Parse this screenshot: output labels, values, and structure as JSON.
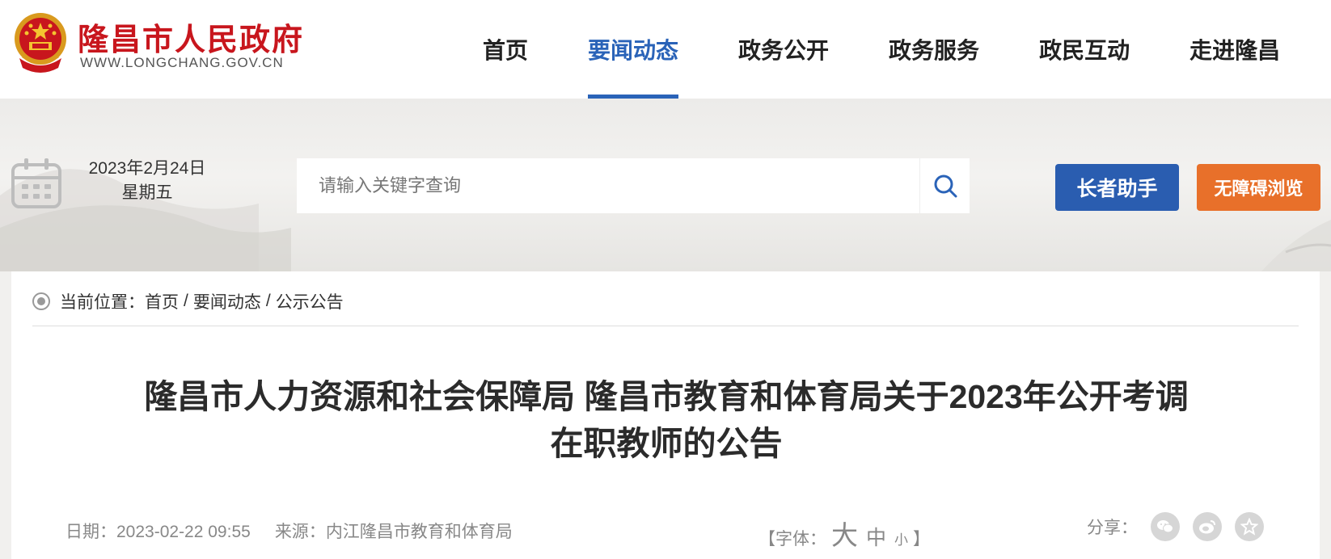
{
  "header": {
    "site_name": "隆昌市人民政府",
    "site_domain": "WWW.LONGCHANG.GOV.CN",
    "nav": [
      {
        "label": "首页",
        "active": false
      },
      {
        "label": "要闻动态",
        "active": true
      },
      {
        "label": "政务公开",
        "active": false
      },
      {
        "label": "政务服务",
        "active": false
      },
      {
        "label": "政民互动",
        "active": false
      },
      {
        "label": "走进隆昌",
        "active": false
      }
    ]
  },
  "toolbar": {
    "date": "2023年2月24日",
    "weekday": "星期五",
    "search_placeholder": "请输入关键字查询",
    "search_value": "",
    "elder_label": "长者助手",
    "accessibility_label": "无障碍浏览"
  },
  "breadcrumb": {
    "prefix": "当前位置：",
    "items": [
      "首页",
      "要闻动态",
      "公示公告"
    ],
    "separator": "/"
  },
  "article": {
    "title_line1": "隆昌市人力资源和社会保障局 隆昌市教育和体育局关于2023年公开考调",
    "title_line2": "在职教师的公告",
    "date_label": "日期：",
    "date_value": "2023-02-22 09:55",
    "source_label": "来源：",
    "source_value": "内江隆昌市教育和体育局",
    "font_label": "【字体：",
    "font_large": "大",
    "font_medium": "中",
    "font_small": "小",
    "font_close": "】",
    "share_label": "分享："
  },
  "colors": {
    "brand_red": "#c8161d",
    "nav_active_blue": "#2a63b8",
    "elder_button": "#2a5db0",
    "accessibility_button": "#e8702a"
  },
  "icons": [
    "national-emblem-icon",
    "calendar-icon",
    "search-icon",
    "radio-dot-icon",
    "wechat-icon",
    "weibo-icon",
    "favorite-icon"
  ]
}
